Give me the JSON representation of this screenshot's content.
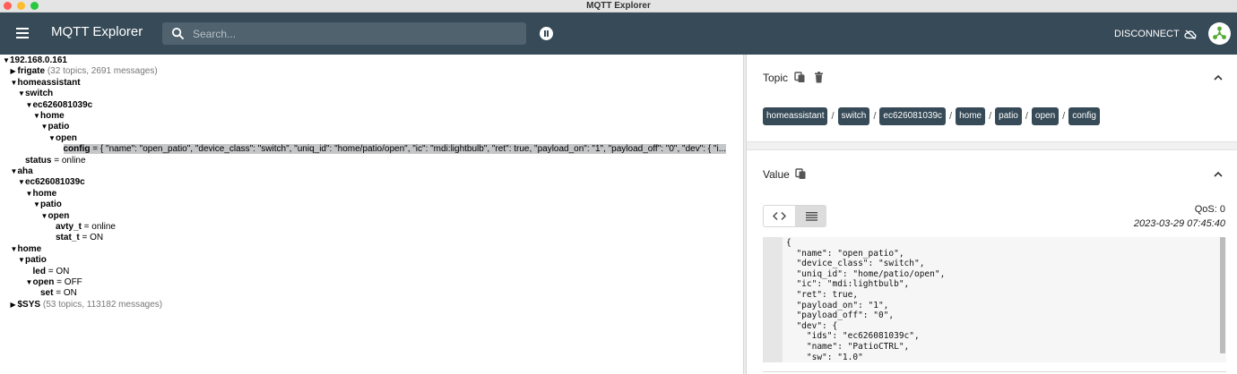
{
  "window": {
    "title": "MQTT Explorer"
  },
  "appbar": {
    "title": "MQTT Explorer",
    "search_placeholder": "Search...",
    "disconnect_label": "DISCONNECT"
  },
  "tree": [
    {
      "indent": 0,
      "arrow": "▼",
      "key": "192.168.0.161",
      "meta": "",
      "value": ""
    },
    {
      "indent": 1,
      "arrow": "▶",
      "key": "frigate",
      "meta": "(32 topics, 2691 messages)",
      "value": ""
    },
    {
      "indent": 1,
      "arrow": "▼",
      "key": "homeassistant",
      "meta": "",
      "value": ""
    },
    {
      "indent": 2,
      "arrow": "▼",
      "key": "switch",
      "meta": "",
      "value": ""
    },
    {
      "indent": 3,
      "arrow": "▼",
      "key": "ec626081039c",
      "meta": "",
      "value": ""
    },
    {
      "indent": 4,
      "arrow": "▼",
      "key": "home",
      "meta": "",
      "value": ""
    },
    {
      "indent": 5,
      "arrow": "▼",
      "key": "patio",
      "meta": "",
      "value": ""
    },
    {
      "indent": 6,
      "arrow": "▼",
      "key": "open",
      "meta": "",
      "value": ""
    },
    {
      "indent": 7,
      "arrow": "",
      "key": "config",
      "meta": "",
      "value": " = { \"name\": \"open_patio\", \"device_class\": \"switch\", \"uniq_id\": \"home/patio/open\", \"ic\": \"mdi:lightbulb\", \"ret\": true, \"payload_on\": \"1\", \"payload_off\": \"0\", \"dev\": { \"i...",
      "selected": true
    },
    {
      "indent": 2,
      "arrow": "",
      "key": "status",
      "meta": "",
      "value": " = online"
    },
    {
      "indent": 1,
      "arrow": "▼",
      "key": "aha",
      "meta": "",
      "value": ""
    },
    {
      "indent": 2,
      "arrow": "▼",
      "key": "ec626081039c",
      "meta": "",
      "value": ""
    },
    {
      "indent": 3,
      "arrow": "▼",
      "key": "home",
      "meta": "",
      "value": ""
    },
    {
      "indent": 4,
      "arrow": "▼",
      "key": "patio",
      "meta": "",
      "value": ""
    },
    {
      "indent": 5,
      "arrow": "▼",
      "key": "open",
      "meta": "",
      "value": ""
    },
    {
      "indent": 6,
      "arrow": "",
      "key": "avty_t",
      "meta": "",
      "value": " = online"
    },
    {
      "indent": 6,
      "arrow": "",
      "key": "stat_t",
      "meta": "",
      "value": " = ON"
    },
    {
      "indent": 1,
      "arrow": "▼",
      "key": "home",
      "meta": "",
      "value": ""
    },
    {
      "indent": 2,
      "arrow": "▼",
      "key": "patio",
      "meta": "",
      "value": ""
    },
    {
      "indent": 3,
      "arrow": "",
      "key": "led",
      "meta": "",
      "value": " = ON"
    },
    {
      "indent": 3,
      "arrow": "▼",
      "key": "open",
      "meta": "",
      "value": " = OFF"
    },
    {
      "indent": 4,
      "arrow": "",
      "key": "set",
      "meta": "",
      "value": " = ON"
    },
    {
      "indent": 1,
      "arrow": "▶",
      "key": "$SYS",
      "meta": "(53 topics, 113182 messages)",
      "value": ""
    }
  ],
  "topic": {
    "heading": "Topic",
    "path": [
      "homeassistant",
      "switch",
      "ec626081039c",
      "home",
      "patio",
      "open",
      "config"
    ]
  },
  "value": {
    "heading": "Value",
    "qos": "QoS: 0",
    "timestamp": "2023-03-29 07:45:40",
    "code_lines": [
      "{",
      "  \"name\": \"open_patio\",",
      "  \"device_class\": \"switch\",",
      "  \"uniq_id\": \"home/patio/open\",",
      "  \"ic\": \"mdi:lightbulb\",",
      "  \"ret\": true,",
      "  \"payload_on\": \"1\",",
      "  \"payload_off\": \"0\",",
      "  \"dev\": {",
      "    \"ids\": \"ec626081039c\",",
      "    \"name\": \"PatioCTRL\",",
      "    \"sw\": \"1.0\""
    ]
  }
}
